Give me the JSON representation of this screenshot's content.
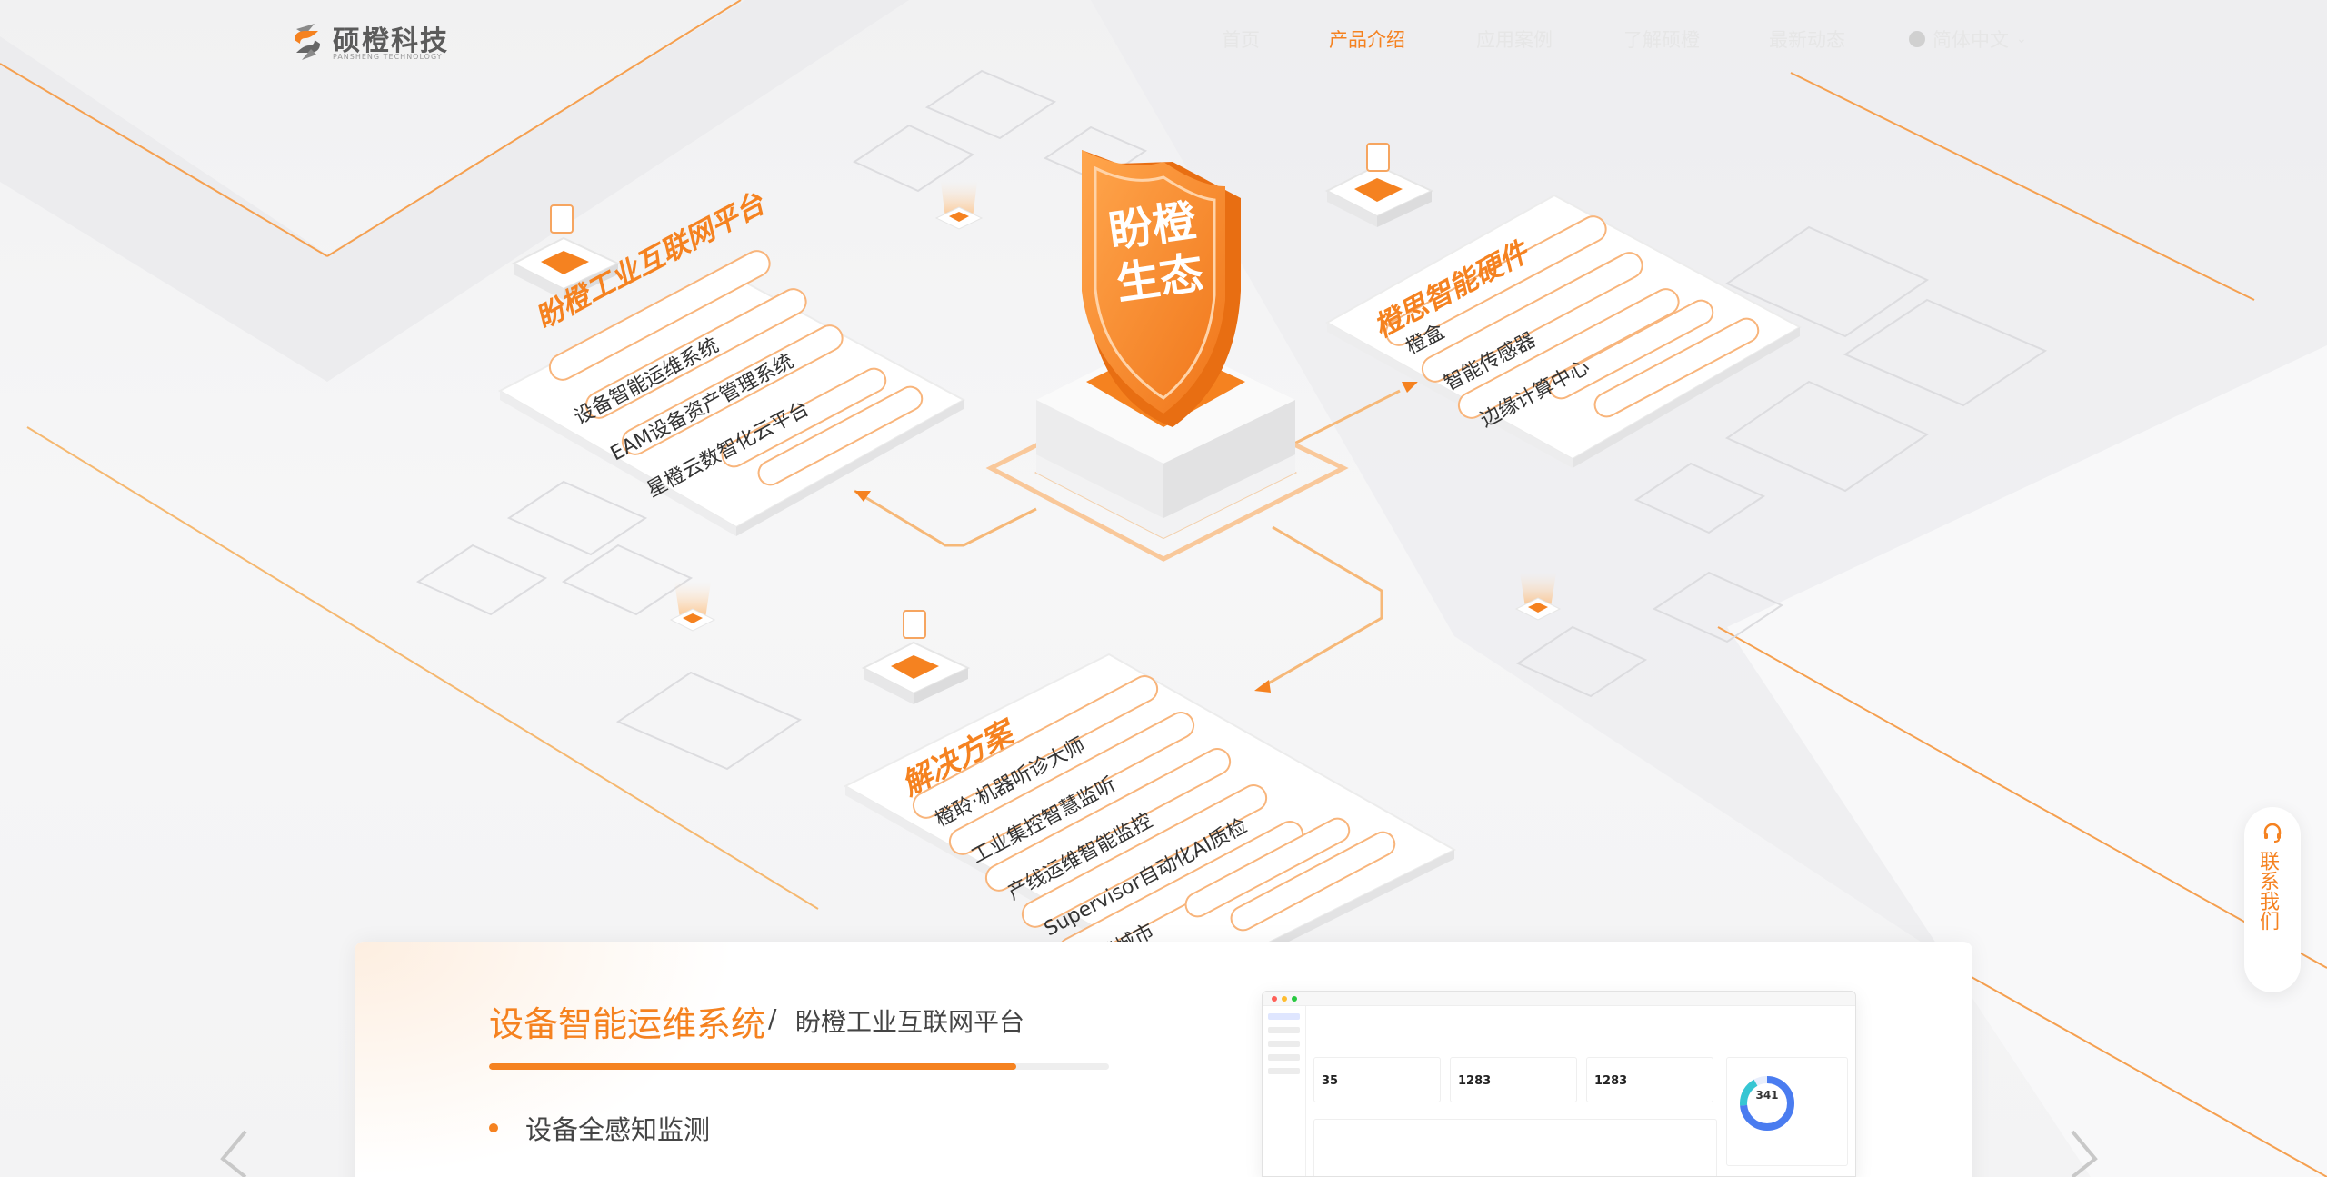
{
  "nav": {
    "logo_text": "硕橙科技",
    "logo_sub": "PANSHENG TECHNOLOGY",
    "items": [
      "首页",
      "产品介绍",
      "应用案例",
      "了解硕橙",
      "最新动态"
    ],
    "active_index": 1,
    "language": "简体中文"
  },
  "hero": {
    "center_shield": [
      "盼橙",
      "生态"
    ],
    "platform_panel": {
      "title": "盼橙工业互联网平台",
      "items": [
        "设备智能运维系统",
        "EAM设备资产管理系统",
        "星橙云数智化云平台"
      ]
    },
    "hardware_panel": {
      "title": "橙思智能硬件",
      "items": [
        "橙盒",
        "智能传感器",
        "边缘计算中心"
      ]
    },
    "solution_panel": {
      "title": "解决方案",
      "items": [
        "橙聆·机器听诊大师",
        "工业集控智慧监听",
        "产线运维智能监控",
        "Supervisor自动化AI质检",
        "智慧城市"
      ]
    }
  },
  "contact": {
    "label": "联系我们"
  },
  "product_card": {
    "title": "设备智能运维系统",
    "separator": "/",
    "subtitle": "盼橙工业互联网平台",
    "progress": 0.85,
    "features": [
      "设备全感知监测"
    ]
  },
  "dashboard": {
    "kpis": [
      {
        "label": "",
        "value": "35"
      },
      {
        "label": "",
        "value": "1283"
      },
      {
        "label": "",
        "value": "1283"
      }
    ],
    "ring_value": "341"
  },
  "colors": {
    "accent": "#f58220",
    "menu_text": "#e6e6e6"
  }
}
